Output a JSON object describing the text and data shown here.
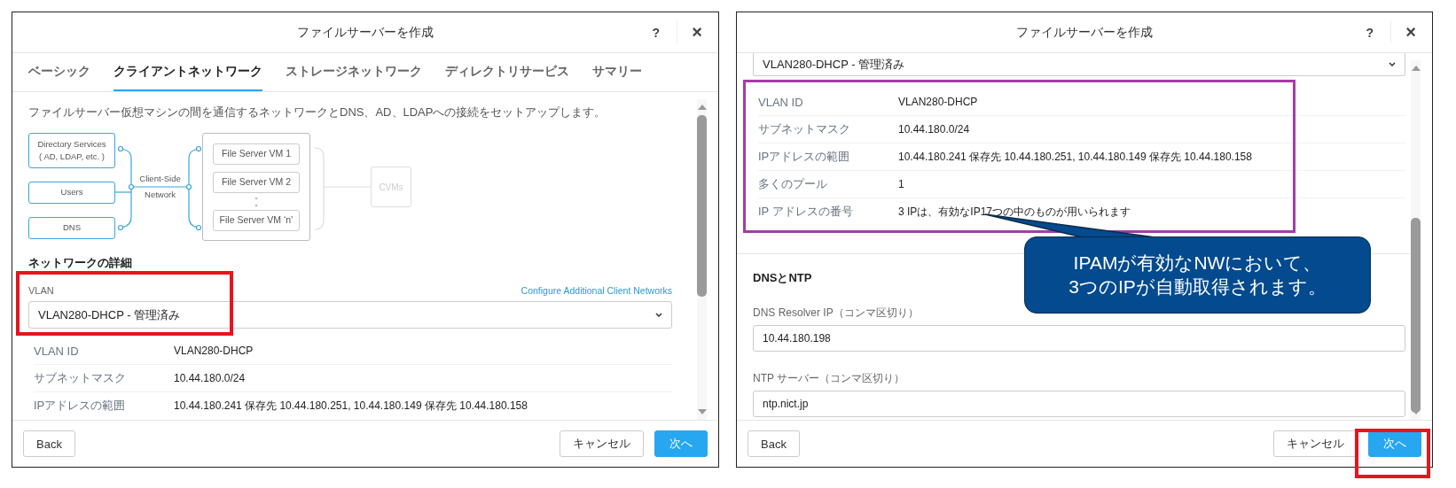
{
  "left_dialog": {
    "title": "ファイルサーバーを作成",
    "help": "?",
    "close": "×",
    "tabs": [
      {
        "label": "ベーシック",
        "selected": false
      },
      {
        "label": "クライアントネットワーク",
        "selected": true
      },
      {
        "label": "ストレージネットワーク",
        "selected": false
      },
      {
        "label": "ディレクトリサービス",
        "selected": false
      },
      {
        "label": "サマリー",
        "selected": false
      }
    ],
    "description": "ファイルサーバー仮想マシンの間を通信するネットワークとDNS、AD、LDAPへの接続をセットアップします。",
    "diagram": {
      "sources": [
        {
          "lines": [
            "Directory Services",
            "( AD, LDAP, etc. )"
          ]
        },
        {
          "lines": [
            "Users"
          ]
        },
        {
          "lines": [
            "DNS"
          ]
        }
      ],
      "network": [
        "Client-Side",
        "Network"
      ],
      "vms": [
        "File Server VM 1",
        "File Server VM 2",
        "File Server VM ‘n’"
      ],
      "target": "CVMs"
    },
    "section_title": "ネットワークの詳細",
    "vlan_label": "VLAN",
    "link": "Configure Additional Client Networks",
    "vlan_select": "VLAN280-DHCP - 管理済み",
    "details": [
      {
        "label": "VLAN ID",
        "value": "VLAN280-DHCP"
      },
      {
        "label": "サブネットマスク",
        "value": "10.44.180.0/24"
      },
      {
        "label": "IPアドレスの範囲",
        "value": "10.44.180.241 保存先 10.44.180.251, 10.44.180.149 保存先 10.44.180.158"
      }
    ],
    "buttons": {
      "back": "Back",
      "cancel": "キャンセル",
      "next": "次へ"
    }
  },
  "right_dialog": {
    "title": "ファイルサーバーを作成",
    "help": "?",
    "close": "×",
    "vlan_select": "VLAN280-DHCP - 管理済み",
    "details": [
      {
        "label": "VLAN ID",
        "value": "VLAN280-DHCP"
      },
      {
        "label": "サブネットマスク",
        "value": "10.44.180.0/24"
      },
      {
        "label": "IPアドレスの範囲",
        "value": "10.44.180.241 保存先 10.44.180.251, 10.44.180.149 保存先 10.44.180.158"
      },
      {
        "label": "多くのプール",
        "value": "1"
      },
      {
        "label": "IP アドレスの番号",
        "value": "3 IPは、有効なIP17つの中のものが用いられます"
      }
    ],
    "section_title": "DNSとNTP",
    "fields": [
      {
        "label": "DNS Resolver IP（コンマ区切り）",
        "value": "10.44.180.198"
      },
      {
        "label": "NTP サーバー（コンマ区切り）",
        "value": "ntp.nict.jp"
      }
    ],
    "buttons": {
      "back": "Back",
      "cancel": "キャンセル",
      "next": "次へ"
    }
  },
  "callout": {
    "lines": [
      "IPAMが有効なNWにおいて、",
      "3つのIPが自動取得されます。"
    ]
  }
}
